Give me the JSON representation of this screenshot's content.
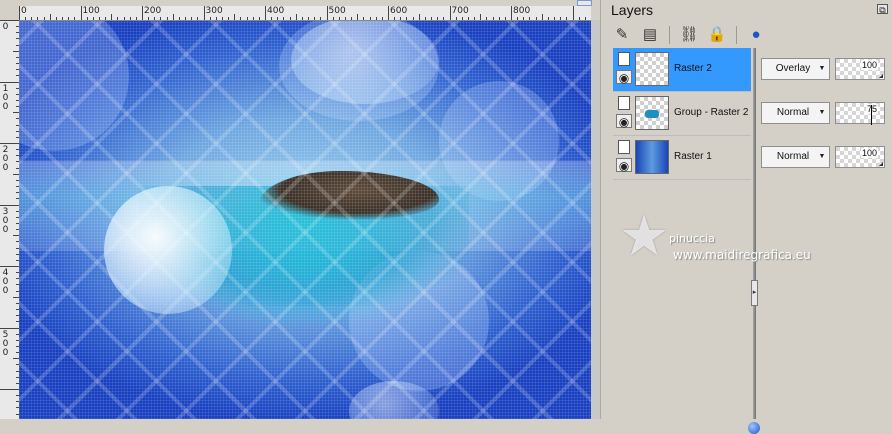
{
  "ruler": {
    "top_labels": [
      "0",
      "100",
      "200",
      "300",
      "400",
      "500",
      "600",
      "700",
      "800"
    ],
    "left_labels": [
      "0",
      "100",
      "200",
      "300",
      "400",
      "500"
    ]
  },
  "layers_panel": {
    "title": "Layers",
    "toolbar_icons": [
      "brush-pencil-icon",
      "new-layer-icon",
      "link-icon",
      "lock-icon",
      "globe-icon"
    ],
    "layers": [
      {
        "name": "Raster 2",
        "blend": "Overlay",
        "opacity": "100",
        "selected": true,
        "thumb": "transparent"
      },
      {
        "name": "Group - Raster 2",
        "blend": "Normal",
        "opacity": "75",
        "selected": false,
        "thumb": "group"
      },
      {
        "name": "Raster 1",
        "blend": "Normal",
        "opacity": "100",
        "selected": false,
        "thumb": "raster"
      }
    ]
  },
  "watermark": {
    "line1": "pinuccia",
    "line2": "www.maidiregrafica.eu"
  },
  "colors": {
    "selected": "#3399ff",
    "panel_bg": "#d4d0c8"
  }
}
